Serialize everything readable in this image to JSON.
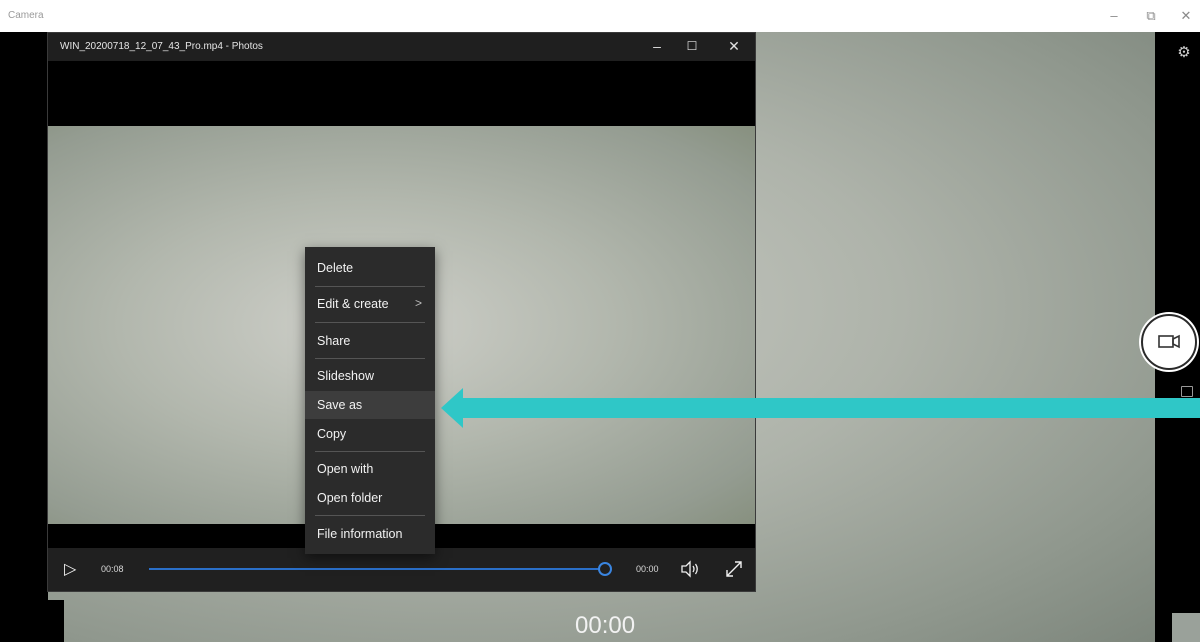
{
  "camera": {
    "title": "Camera",
    "minimize": "–",
    "restore": "⧉",
    "close": "✕",
    "timer": "00:00"
  },
  "photos": {
    "title": "WIN_20200718_12_07_43_Pro.mp4 - Photos",
    "minimize": "–",
    "maximize": "☐",
    "close": "✕",
    "player": {
      "elapsed": "00:08",
      "remaining": "00:00",
      "progress_percent": 100
    }
  },
  "context_menu": {
    "items": [
      {
        "label": "Delete"
      },
      {
        "label": "Edit & create",
        "submenu": true
      },
      {
        "label": "Share"
      },
      {
        "label": "Slideshow"
      },
      {
        "label": "Save as",
        "highlighted": true
      },
      {
        "label": "Copy"
      },
      {
        "label": "Open with"
      },
      {
        "label": "Open folder"
      },
      {
        "label": "File information"
      }
    ]
  },
  "icons": {
    "play": "▷",
    "volume": "🔊",
    "fullscreen": "⤢",
    "settings": "⚙",
    "video_camera": "video-camera-icon",
    "submenu_chevron": ">"
  },
  "colors": {
    "annotation_arrow": "#2fc7c7",
    "progress": "#2a6fc9",
    "menu_bg": "#2b2b2b",
    "menu_hover": "#3d3d3d"
  }
}
